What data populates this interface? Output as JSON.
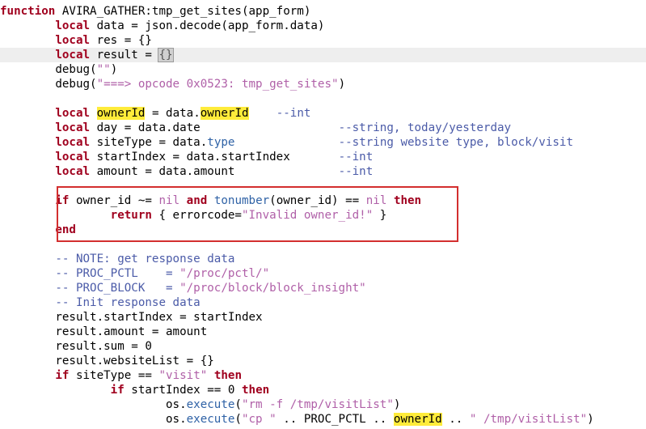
{
  "code": {
    "l1": {
      "kw": "function",
      "rest": " AVIRA_GATHER:tmp_get_sites(app_form)"
    },
    "l2": {
      "kw": "local",
      "rest": " data = json.decode(app_form.data)"
    },
    "l3": {
      "kw": "local",
      "rest": " res = {}"
    },
    "l4": {
      "kw": "local",
      "rest": " result = ",
      "cursor": "{}"
    },
    "l5": {
      "a": "debug(",
      "s": "\"\"",
      "b": ")"
    },
    "l6": {
      "a": "debug(",
      "s": "\"===> opcode 0x0523: tmp_get_sites\"",
      "b": ")"
    },
    "l7": {
      "kw": "local",
      "hl1": "ownerId",
      "mid": " = data.",
      "hl2": "ownerId",
      "cmt": "    --int"
    },
    "l8": {
      "kw": "local",
      "rest": " day = data.date                    ",
      "cmt": "--string, today/yesterday"
    },
    "l9": {
      "kw": "local",
      "a": " siteType = data.",
      "fn": "type",
      "pad": "               ",
      "cmt": "--string website type, block/visit"
    },
    "l10": {
      "kw": "local",
      "rest": " startIndex = data.startIndex       ",
      "cmt": "--int"
    },
    "l11": {
      "kw": "local",
      "rest": " amount = data.amount               ",
      "cmt": "--int"
    },
    "l12": {
      "kw_if": "if",
      "a": " owner_id ~= ",
      "nil1": "nil",
      "kw_and": "and",
      "fn": "tonumber",
      "b": "(owner_id) == ",
      "nil2": "nil",
      "kw_then": "then"
    },
    "l13": {
      "kw": "return",
      "a": " { errorcode=",
      "s": "\"Invalid owner_id!\"",
      "b": " }"
    },
    "l14": {
      "kw": "end"
    },
    "l15": {
      "cmt": "-- NOTE: get response data"
    },
    "l16": {
      "a": "-- PROC_PCTL    = ",
      "s": "\"/proc/pctl/\""
    },
    "l17": {
      "a": "-- PROC_BLOCK   = ",
      "s": "\"/proc/block/block_insight\""
    },
    "l18": {
      "cmt": "-- Init response data"
    },
    "l19": {
      "rest": "result.startIndex = startIndex"
    },
    "l20": {
      "rest": "result.amount = amount"
    },
    "l21": {
      "rest": "result.sum = 0"
    },
    "l22": {
      "rest": "result.websiteList = {}"
    },
    "l23": {
      "kw_if": "if",
      "a": " siteType == ",
      "s": "\"visit\"",
      "kw_then": "then"
    },
    "l24": {
      "kw_if": "if",
      "a": " startIndex == 0 ",
      "kw_then": "then"
    },
    "l25": {
      "a": "os.",
      "fn": "execute",
      "b": "(",
      "s": "\"rm -f /tmp/visitList\"",
      "c": ")"
    },
    "l26": {
      "a": "os.",
      "fn": "execute",
      "b": "(",
      "s1": "\"cp \"",
      "mid": " .. PROC_PCTL .. ",
      "hl": "ownerId",
      "mid2": " .. ",
      "s2": "\" /tmp/visitList\"",
      "c": ")"
    }
  }
}
